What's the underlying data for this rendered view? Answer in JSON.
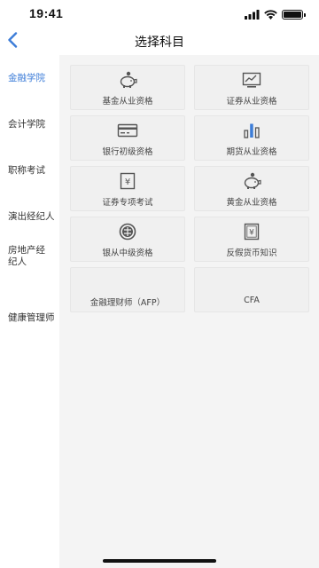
{
  "status_bar": {
    "time": "19:41"
  },
  "nav": {
    "title": "选择科目"
  },
  "sidebar": {
    "items": [
      {
        "label": "金融学院"
      },
      {
        "label": "会计学院"
      },
      {
        "label": "职称考试"
      },
      {
        "label": "演出经纪人"
      },
      {
        "label": "房地产经纪人"
      },
      {
        "label": "健康管理师"
      }
    ]
  },
  "subjects": [
    {
      "label": "基金从业资格",
      "icon": "piggy-bank-icon"
    },
    {
      "label": "证券从业资格",
      "icon": "stock-chart-icon"
    },
    {
      "label": "银行初级资格",
      "icon": "bank-card-icon"
    },
    {
      "label": "期货从业资格",
      "icon": "bar-chart-icon"
    },
    {
      "label": "证券专项考试",
      "icon": "receipt-yuan-icon"
    },
    {
      "label": "黄金从业资格",
      "icon": "piggy-bank-icon"
    },
    {
      "label": "银从中级资格",
      "icon": "coin-icon"
    },
    {
      "label": "反假货币知识",
      "icon": "banknote-yuan-icon"
    },
    {
      "label": "金融理财师（AFP）",
      "icon": ""
    },
    {
      "label": "CFA",
      "icon": ""
    }
  ],
  "colors": {
    "accent": "#3d7dd8",
    "icon": "#555555",
    "panel_bg": "#f4f4f4",
    "card_bg": "#f0f0f0"
  }
}
